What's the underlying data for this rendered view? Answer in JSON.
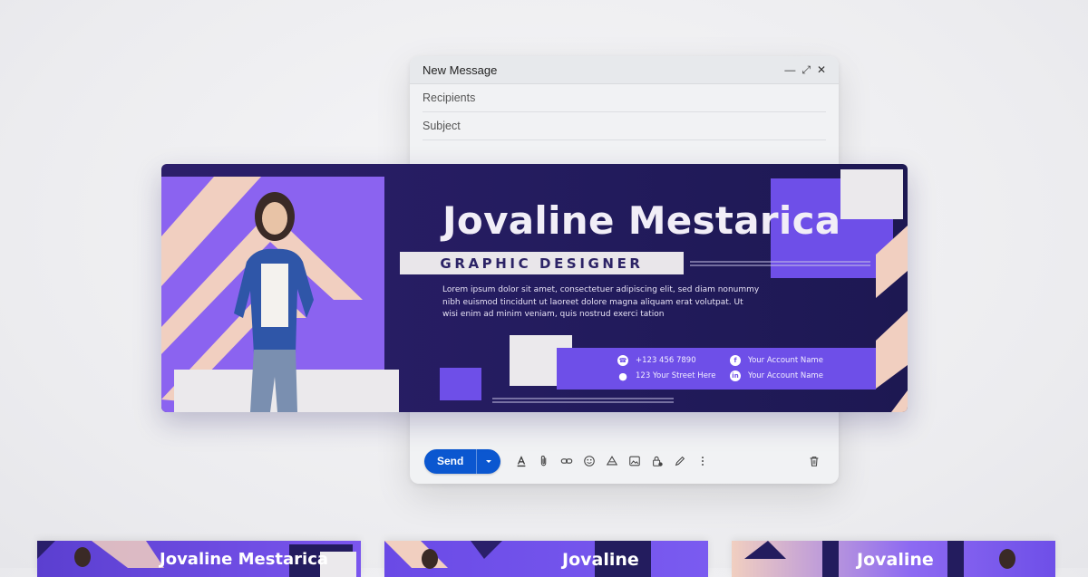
{
  "compose": {
    "title": "New Message",
    "recipients_placeholder": "Recipients",
    "subject_placeholder": "Subject",
    "send_label": "Send",
    "icons": [
      "minimize-icon",
      "expand-icon",
      "close-icon",
      "format-text-icon",
      "attach-icon",
      "link-icon",
      "emoji-icon",
      "drive-icon",
      "image-icon",
      "lock-icon",
      "signature-icon",
      "more-icon",
      "trash-icon"
    ]
  },
  "signature": {
    "name": "Jovaline Mestarica",
    "role": "GRAPHIC DESIGNER",
    "body": "Lorem ipsum dolor sit amet, consectetuer adipiscing elit, sed diam nonummy nibh euismod tincidunt ut laoreet dolore magna aliquam erat volutpat. Ut wisi enim ad minim veniam, quis nostrud exerci tation",
    "phone": "+123 456 7890",
    "address": "123 Your Street Here",
    "facebook": "Your Account Name",
    "linkedin": "Your Account Name",
    "colors": {
      "navy": "#231c5e",
      "purple": "#6e4fe8",
      "peach": "#f1cfc0",
      "light": "#e8e6ea"
    }
  },
  "thumbnails": [
    {
      "name": "Jovaline Mestarica"
    },
    {
      "name": "Jovaline"
    },
    {
      "name": "Jovaline"
    }
  ]
}
